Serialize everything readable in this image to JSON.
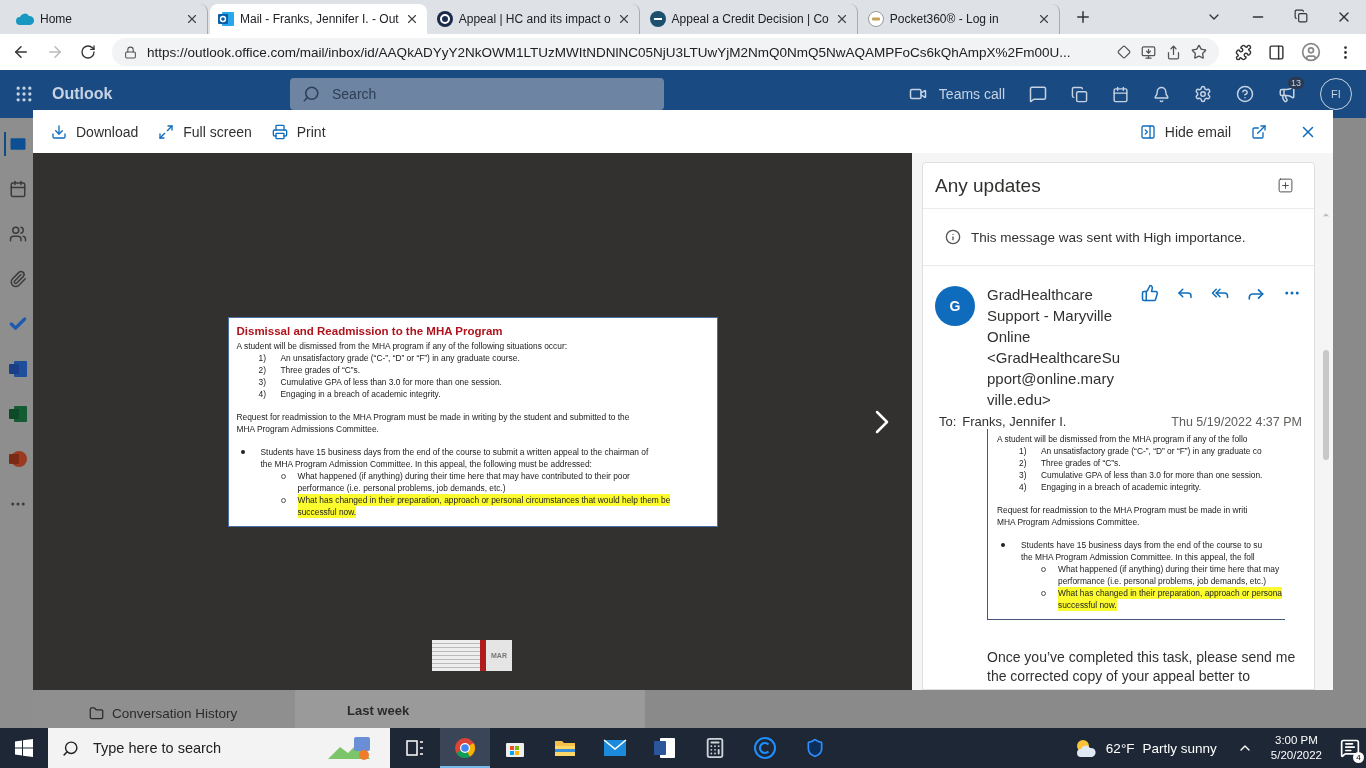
{
  "browser": {
    "tabs": [
      {
        "title": "Home",
        "kind": "cloud",
        "selected": false
      },
      {
        "title": "Mail - Franks, Jennifer I. - Out",
        "kind": "outlook",
        "selected": true
      },
      {
        "title": "Appeal | HC and its impact o",
        "kind": "ring",
        "selected": false
      },
      {
        "title": "Appeal a Credit Decision | Co",
        "kind": "seal",
        "selected": false
      },
      {
        "title": "Pocket360® - Log in",
        "kind": "badge",
        "selected": false
      }
    ],
    "url": "https://outlook.office.com/mail/inbox/id/AAQkADYyY2NkOWM1LTUzMWItNDNlNC05NjU3LTUwYjM2NmQ0NmQ5NwAQAMPFoCs6kQhAmpX%2Fm00U..."
  },
  "outlook": {
    "app_name": "Outlook",
    "search": {
      "placeholder": "Search"
    },
    "teams_call": "Teams call",
    "notification_count": "13",
    "avatar": "FI",
    "rail": [
      {
        "kind": "mail",
        "selected": true
      },
      {
        "kind": "calendar",
        "selected": false
      },
      {
        "kind": "people",
        "selected": false
      },
      {
        "kind": "files",
        "selected": false
      },
      {
        "kind": "todo",
        "selected": false
      },
      {
        "kind": "word",
        "selected": false
      },
      {
        "kind": "excel",
        "selected": false
      },
      {
        "kind": "powerpoint",
        "selected": false
      },
      {
        "kind": "more",
        "selected": false
      }
    ],
    "folder": "Conversation History",
    "list_group": "Last week"
  },
  "viewer": {
    "toolbar": {
      "download": "Download",
      "full_screen": "Full screen",
      "print": "Print",
      "hide_email": "Hide email"
    },
    "document": {
      "title": "Dismissal and Readmission to the MHA Program",
      "intro": "A student will be dismissed from the MHA program if any of the following situations occur:",
      "items": [
        {
          "n": "1)",
          "text": "An unsatisfactory grade (“C-”, “D” or “F”) in any graduate course."
        },
        {
          "n": "2)",
          "text": "Three grades of “C”s."
        },
        {
          "n": "3)",
          "text": "Cumulative GPA of less than 3.0 for more than one session."
        },
        {
          "n": "4)",
          "text": "Engaging in a breach of academic integrity."
        }
      ],
      "request": [
        "Request for readmission to the MHA Program must be made in writing by the student and submitted to the",
        "MHA Program Admissions Committee."
      ],
      "bullet": [
        "Students have 15 business days from the end of the course to submit a written appeal to the chairman of",
        "the MHA Program Admission Committee.  In this appeal, the following must be addressed:"
      ],
      "sub_items": [
        {
          "lines": [
            "What happened (if anything) during their time here that may have contributed to their poor",
            "performance (i.e. personal problems, job demands, etc.)"
          ],
          "highlighted": false
        },
        {
          "lines": [
            "What has changed in their preparation, approach or personal circumstances that would help them be",
            "successful now."
          ],
          "highlighted": true
        }
      ]
    },
    "thumbnail": {
      "label": "MAR"
    }
  },
  "email": {
    "subject": "Any updates",
    "importance_notice": "This message was sent with High importance.",
    "avatar": "G",
    "sender": "GradHealthcare Support - Maryville Online <GradHealthcareSupport@online.maryville.edu>",
    "to_label": "To:",
    "to": "Franks, Jennifer I.",
    "date": "Thu 5/19/2022 4:37 PM",
    "excerpt": {
      "intro": "A student will be dismissed from the MHA program if any of the follo",
      "items": [
        {
          "n": "1)",
          "text": "An unsatisfactory grade (“C-”, “D” or “F”) in any graduate co"
        },
        {
          "n": "2)",
          "text": "Three grades of “C”s."
        },
        {
          "n": "3)",
          "text": "Cumulative GPA of less than 3.0 for more than one session."
        },
        {
          "n": "4)",
          "text": "Engaging in a breach of academic integrity."
        }
      ],
      "request": [
        "Request for readmission to the MHA Program must be made in writi",
        "MHA Program Admissions Committee."
      ],
      "bullet": [
        "Students have 15 business days from the end of the course to su",
        "the MHA Program Admission Committee.  In this appeal, the foll"
      ],
      "sub_items": [
        {
          "lines": [
            "What happened (if anything) during their time here that may",
            "performance (i.e. personal problems, job demands, etc.)"
          ],
          "highlighted": false
        },
        {
          "lines": [
            "What has changed in their preparation, approach or persona",
            "successful now."
          ],
          "highlighted": true
        }
      ]
    },
    "body": [
      "Once you’ve completed this task, please send me",
      "the corrected copy of your appeal better to"
    ]
  },
  "taskbar": {
    "search": {
      "placeholder": "Type here to search"
    },
    "apps": [
      {
        "kind": "taskview",
        "selected": false
      },
      {
        "kind": "chrome",
        "selected": true
      },
      {
        "kind": "store",
        "selected": false
      },
      {
        "kind": "explorer",
        "selected": false
      },
      {
        "kind": "mail",
        "selected": false
      },
      {
        "kind": "word",
        "selected": false
      },
      {
        "kind": "calculator",
        "selected": false
      },
      {
        "kind": "c-app",
        "selected": false
      },
      {
        "kind": "shield",
        "selected": false
      }
    ],
    "temperature": "62°F",
    "weather": "Partly sunny",
    "time": "3:00 PM",
    "date": "5/20/2022",
    "notifications": "4"
  }
}
